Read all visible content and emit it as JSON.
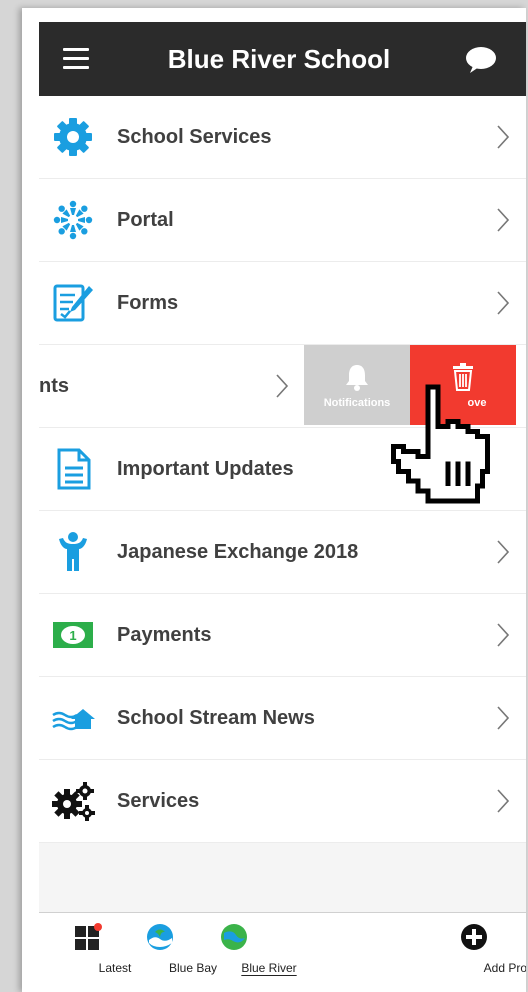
{
  "header": {
    "title": "Blue River School",
    "menu_icon": "hamburger-menu-icon",
    "chat_icon": "chat-bubble-icon"
  },
  "list": {
    "items": [
      {
        "label": "School Services",
        "icon": "gear-icon"
      },
      {
        "label": "Portal",
        "icon": "people-circle-icon"
      },
      {
        "label": "Forms",
        "icon": "form-edit-icon"
      },
      {
        "label": "nts",
        "icon": ""
      },
      {
        "label": "Important Updates",
        "icon": "document-icon"
      },
      {
        "label": "Japanese Exchange 2018",
        "icon": "person-icon"
      },
      {
        "label": "Payments",
        "icon": "banknote-icon"
      },
      {
        "label": "School Stream News",
        "icon": "stream-house-icon"
      },
      {
        "label": "Services",
        "icon": "gears-icon"
      }
    ]
  },
  "swipe_actions": {
    "notifications_label": "Notifications",
    "remove_label": "ove"
  },
  "tabbar": {
    "latest_label": "Latest",
    "bluebay_label": "Blue Bay",
    "blueriver_label": "Blue River",
    "addprofile_label": "Add Profile"
  },
  "colors": {
    "header_bg": "#2b2b2b",
    "icon_blue": "#1a9ee0",
    "remove_red": "#f23a2f",
    "notifications_gray": "#cfcfcf",
    "payments_green": "#2cae4a"
  }
}
